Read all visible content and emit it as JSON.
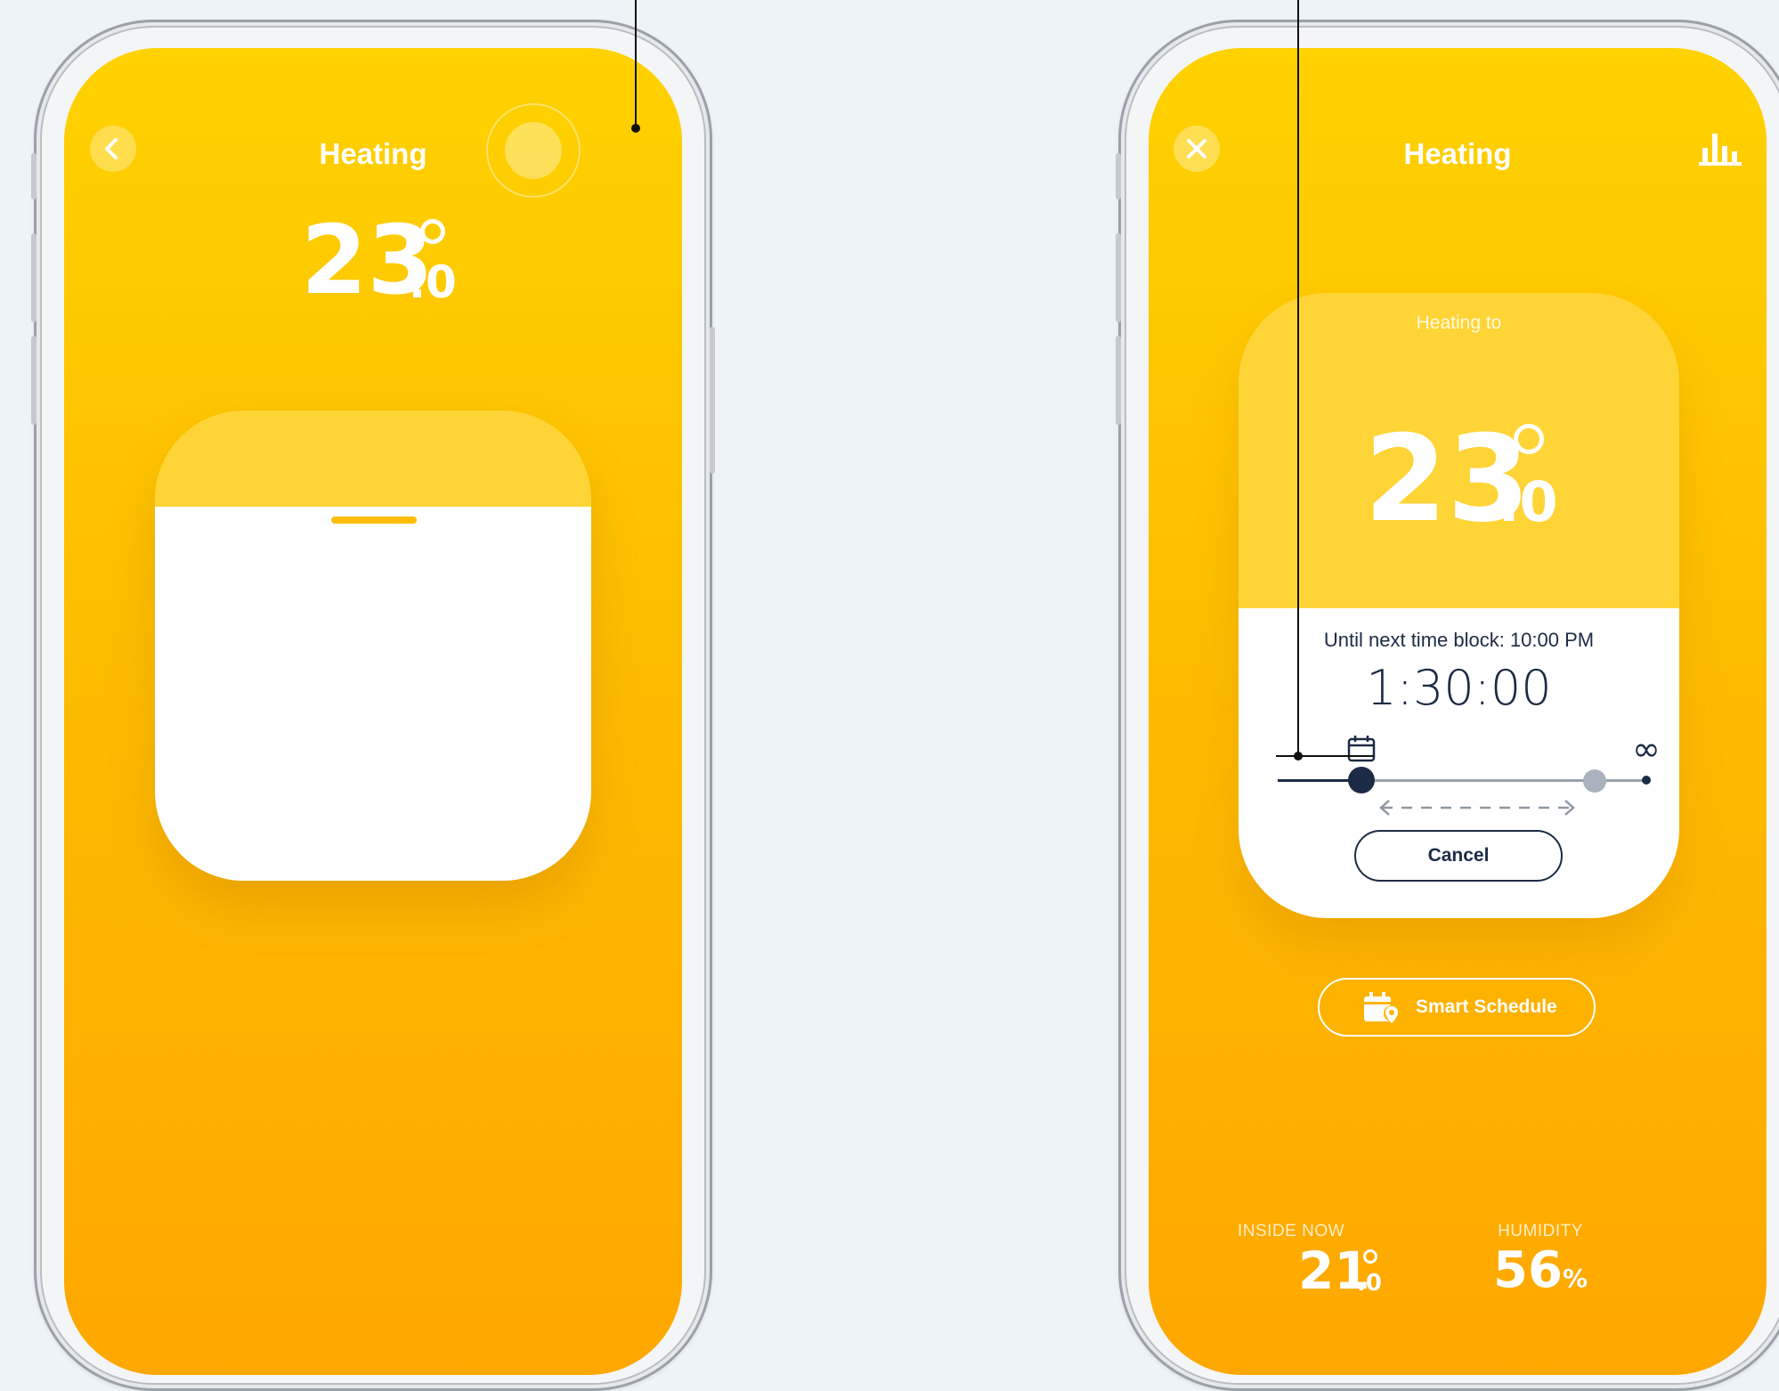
{
  "left_phone": {
    "title": "Heating",
    "target_temp": {
      "whole": "23",
      "decimal": ".0"
    },
    "icons": {
      "back": "chevron-left-icon",
      "action": "circle-icon"
    }
  },
  "right_phone": {
    "title": "Heating",
    "icons": {
      "close": "close-icon",
      "stats": "bar-chart-icon",
      "calendar": "calendar-icon",
      "infinity": "infinity-icon",
      "schedule": "calendar-location-icon"
    },
    "card": {
      "heading": "Heating to",
      "target_temp": {
        "whole": "23",
        "decimal": ".0"
      },
      "until_text": "Until next time block: 10:00 PM",
      "countdown": "1:30:00",
      "cancel_label": "Cancel",
      "infinity_symbol": "∞"
    },
    "smart_schedule_label": "Smart Schedule",
    "inside_now": {
      "label": "INSIDE NOW",
      "whole": "21",
      "decimal": ".0"
    },
    "humidity": {
      "label": "HUMIDITY",
      "value": "56",
      "unit": "%"
    }
  },
  "colors": {
    "gradient_top": "#ffd200",
    "gradient_bottom": "#fea700",
    "navy": "#1c2b45",
    "white": "#ffffff"
  }
}
